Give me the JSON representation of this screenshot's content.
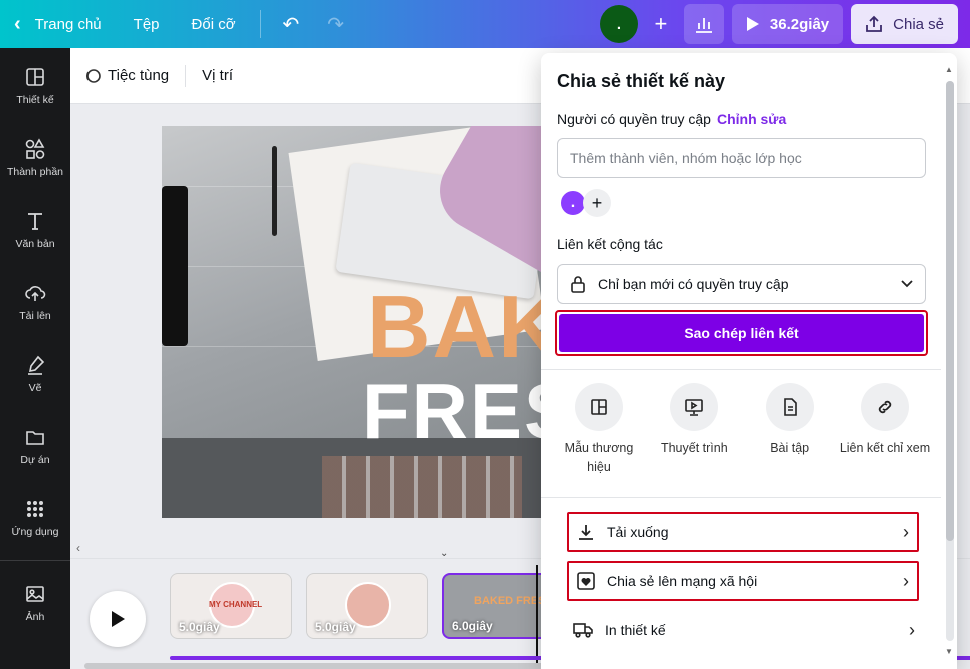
{
  "topbar": {
    "home": "Trang chủ",
    "file": "Tệp",
    "resize": "Đổi cỡ",
    "avatar_initial": ".",
    "play_duration": "36.2giây",
    "share": "Chia sẻ"
  },
  "sidebar": {
    "items": [
      {
        "label": "Thiết kế",
        "icon": "layout-icon"
      },
      {
        "label": "Thành phần",
        "icon": "shapes-icon"
      },
      {
        "label": "Văn bản",
        "icon": "text-icon"
      },
      {
        "label": "Tải lên",
        "icon": "upload-icon"
      },
      {
        "label": "Vẽ",
        "icon": "draw-icon"
      },
      {
        "label": "Dự án",
        "icon": "folder-icon"
      },
      {
        "label": "Ứng dụng",
        "icon": "apps-icon"
      },
      {
        "label": "Ảnh",
        "icon": "photo-icon"
      }
    ]
  },
  "editor_toolbar": {
    "animate": "Tiệc tùng",
    "position": "Vị trí"
  },
  "design": {
    "headline1": "BAKE",
    "headline2": "FRES"
  },
  "timeline": {
    "clips": [
      {
        "duration": "5.0giây",
        "brand": "MY CHANNEL"
      },
      {
        "duration": "5.0giây"
      },
      {
        "duration": "6.0giây",
        "brand": "BAKED FRESH"
      }
    ]
  },
  "share_panel": {
    "title": "Chia sẻ thiết kế này",
    "access_label": "Người có quyền truy cập",
    "access_edit": "Chỉnh sửa",
    "invite_placeholder": "Thêm thành viên, nhóm hoặc lớp học",
    "member_initial": ".",
    "collab_label": "Liên kết cộng tác",
    "collab_value": "Chỉ bạn mới có quyền truy cập",
    "copy_link": "Sao chép liên kết",
    "options": [
      {
        "label": "Mẫu thương hiệu",
        "icon": "template-icon"
      },
      {
        "label": "Thuyết trình",
        "icon": "present-icon"
      },
      {
        "label": "Bài tập",
        "icon": "assignment-icon"
      },
      {
        "label": "Liên kết chỉ xem",
        "icon": "link-icon"
      }
    ],
    "rows": [
      {
        "label": "Tải xuống",
        "icon": "download-icon"
      },
      {
        "label": "Chia sẻ lên mạng xã hội",
        "icon": "heart-icon"
      },
      {
        "label": "In thiết kế",
        "icon": "truck-icon"
      }
    ]
  },
  "colors": {
    "accent": "#7d2ae8",
    "copy_button": "#7d00e6",
    "highlight_box": "#d0021b"
  }
}
